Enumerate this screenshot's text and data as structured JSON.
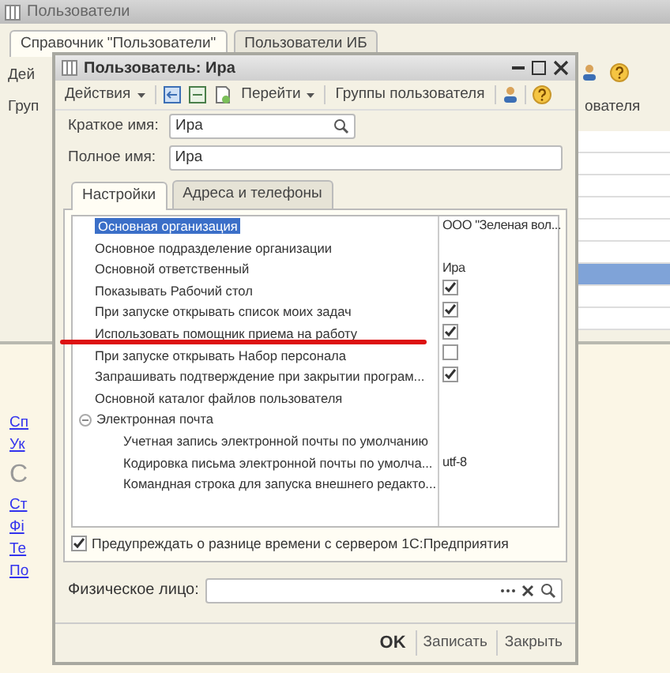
{
  "main_window": {
    "title": "Пользователи",
    "tabs": [
      {
        "label": "Справочник \"Пользователи\"",
        "selected": true
      },
      {
        "label": "Пользователи ИБ",
        "selected": false
      }
    ],
    "toolbar_fragment": "Дей",
    "column_1_fragment": "Груп",
    "column_2_fragment": "ователя",
    "rows": [
      {
        "selected": false
      },
      {
        "selected": false
      },
      {
        "selected": false
      },
      {
        "selected": false
      },
      {
        "selected": false
      },
      {
        "selected": false
      },
      {
        "selected": true
      },
      {
        "selected": false
      },
      {
        "selected": false
      }
    ]
  },
  "side_items": [
    {
      "kind": "link",
      "text": "Сп"
    },
    {
      "kind": "link",
      "text": "Ук"
    },
    {
      "kind": "heading",
      "text": "С"
    },
    {
      "kind": "link",
      "text": "Ст"
    },
    {
      "kind": "link",
      "text": "Фі"
    },
    {
      "kind": "link",
      "text": "Те"
    },
    {
      "kind": "link",
      "text": "По"
    }
  ],
  "dialog": {
    "title": "Пользователь: Ира",
    "toolbar": {
      "actions": "Действия",
      "goto": "Перейти",
      "groups": "Группы пользователя"
    },
    "short_name": {
      "label": "Краткое имя:",
      "value": "Ира"
    },
    "full_name": {
      "label": "Полное имя:",
      "value": "Ира"
    },
    "tabs": [
      {
        "label": "Настройки",
        "selected": true
      },
      {
        "label": "Адреса и телефоны",
        "selected": false
      }
    ],
    "settings": [
      {
        "kind": "text",
        "name": "Основная организация",
        "value": "ООО \"Зеленая вол...",
        "selected": true
      },
      {
        "kind": "text",
        "name": "Основное подразделение организации",
        "selected": false
      },
      {
        "kind": "text",
        "name": "Основной ответственный",
        "value": "Ира",
        "selected": false
      },
      {
        "kind": "check",
        "name": "Показывать Рабочий стол",
        "checked": true,
        "selected": false
      },
      {
        "kind": "check",
        "name": "При запуске открывать список моих задач",
        "checked": true,
        "selected": false
      },
      {
        "kind": "check",
        "name": "Использовать помощник приема на работу",
        "checked": true,
        "selected": false,
        "highlighted": true
      },
      {
        "kind": "check",
        "name": "При запуске открывать Набор персонала",
        "checked": false,
        "selected": false
      },
      {
        "kind": "check",
        "name": "Запрашивать подтверждение при закрытии програм...",
        "checked": true,
        "selected": false
      },
      {
        "kind": "text",
        "name": "Основной каталог файлов пользователя",
        "selected": false
      },
      {
        "kind": "group",
        "name": "Электронная почта",
        "expanded": true,
        "selected": false,
        "children": [
          {
            "kind": "text",
            "name": "Учетная запись электронной почты по умолчанию",
            "selected": false
          },
          {
            "kind": "text",
            "name": "Кодировка письма электронной почты по умолча...",
            "value": "utf-8",
            "selected": false
          },
          {
            "kind": "text",
            "name": "Командная строка для запуска внешнего редакто...",
            "selected": false
          }
        ]
      }
    ],
    "time_warning": {
      "label": "Предупреждать о разнице времени с сервером 1С:Предприятия",
      "checked": true
    },
    "physical_person": {
      "label": "Физическое лицо:"
    },
    "buttons": [
      {
        "label": "OK",
        "default": true
      },
      {
        "label": "Записать",
        "default": false
      },
      {
        "label": "Закрыть",
        "default": false
      }
    ]
  }
}
